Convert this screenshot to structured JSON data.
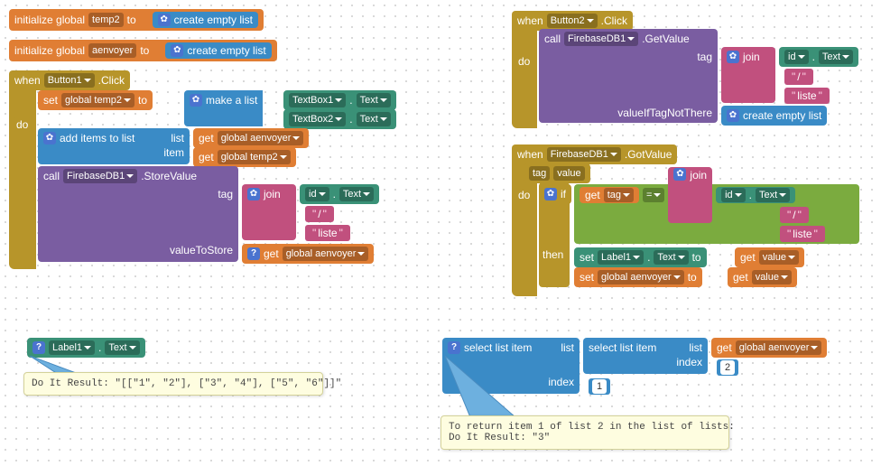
{
  "globals": {
    "init": "initialize global",
    "to": "to",
    "temp2": "temp2",
    "aenvoyer": "aenvoyer"
  },
  "lists": {
    "createEmpty": "create empty list",
    "makeList": "make a list",
    "addItems": "add items to list",
    "list": "list",
    "item": "item",
    "selectListItem": "select list item",
    "index": "index"
  },
  "events": {
    "when": "when",
    "do": "do",
    "click": ".Click",
    "gotValue": ".GotValue",
    "button1": "Button1",
    "button2": "Button2",
    "firebase": "FirebaseDB1",
    "tag": "tag",
    "value": "value"
  },
  "cmds": {
    "set": "set",
    "get": "get",
    "to": "to",
    "call": "call",
    "storeValue": ".StoreValue",
    "getValue": ".GetValue",
    "valueToStore": "valueToStore",
    "valueIfNot": "valueIfTagNotThere",
    "join": "join",
    "if": "if",
    "then": "then",
    "eq": "="
  },
  "components": {
    "textbox1": "TextBox1",
    "textbox2": "TextBox2",
    "label1": "Label1",
    "id": "id",
    "text": "Text"
  },
  "vars": {
    "globalTemp2": "global temp2",
    "globalAenvoyer": "global aenvoyer",
    "tag": "tag",
    "value": "value"
  },
  "strings": {
    "slash": "/",
    "liste": "liste"
  },
  "numbers": {
    "one": "1",
    "two": "2"
  },
  "tooltips": {
    "t1": "Do It Result: \"[[\"1\", \"2\"], [\"3\", \"4\"], [\"5\", \"6\"]]\"",
    "t2": "To return item 1 of list 2 in the list of lists:\nDo It Result: \"3\""
  }
}
